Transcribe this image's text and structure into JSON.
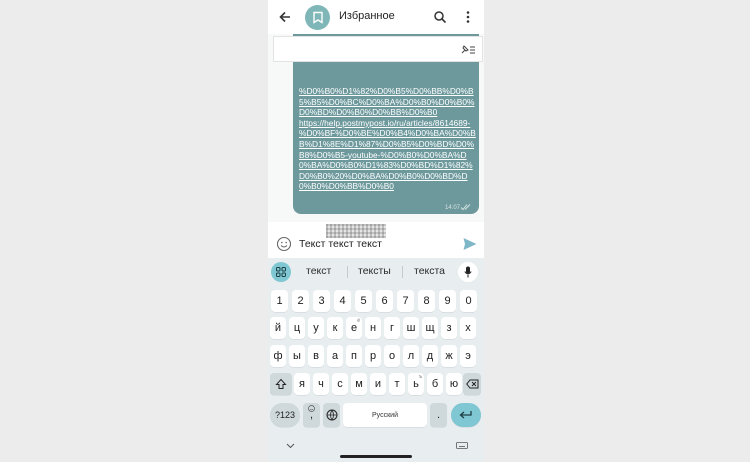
{
  "header": {
    "title": "Избранное",
    "back_icon": "arrow-left-icon",
    "search_icon": "search-icon",
    "menu_icon": "more-vert-icon"
  },
  "message": {
    "text": "%D0%B0%D1%82%D0%B5%D0%BB%D0%B5%B5%D0%BC%D0%BA%D0%B0%D0%B0%D0%BD%D0%B0%D0%BB%D0%B0\nhttps://help.postmypost.io/ru/articles/8614689-%D0%BF%D0%BE%D0%B4%D0%BA%D0%BB%D1%8E%D1%87%D0%B5%D0%BD%D0%B8%D0%B5-youtube-%D0%B0%D0%BA%D0%BA%D0%B0%D1%83%D0%BD%D1%82%D0%B0%20%D0%BA%D0%B0%D0%BD%D0%B0%D0%BB%D0%B0",
    "time": "14:07",
    "bubble_color": "#6d999d"
  },
  "composer": {
    "text": "Текст текст текст"
  },
  "keyboard": {
    "suggestions": [
      "текст",
      "тексты",
      "текста"
    ],
    "accent_color": "#7fc7d3",
    "row_numbers": [
      "1",
      "2",
      "3",
      "4",
      "5",
      "6",
      "7",
      "8",
      "9",
      "0"
    ],
    "row1": [
      "й",
      "ц",
      "у",
      "к",
      "е",
      "н",
      "г",
      "ш",
      "щ",
      "з",
      "х"
    ],
    "row1_hints": [
      "",
      "",
      "",
      "",
      "ё",
      "",
      "",
      "",
      "",
      "",
      ""
    ],
    "row2": [
      "ф",
      "ы",
      "в",
      "а",
      "п",
      "р",
      "о",
      "л",
      "д",
      "ж",
      "э"
    ],
    "row3": [
      "я",
      "ч",
      "с",
      "м",
      "и",
      "т",
      "ь",
      "б",
      "ю"
    ],
    "row3_hints": [
      "",
      "",
      "",
      "",
      "",
      "",
      "ъ",
      "",
      ""
    ],
    "symbols_label": "?123",
    "comma": ",",
    "space_label": "Русский",
    "period": "."
  }
}
